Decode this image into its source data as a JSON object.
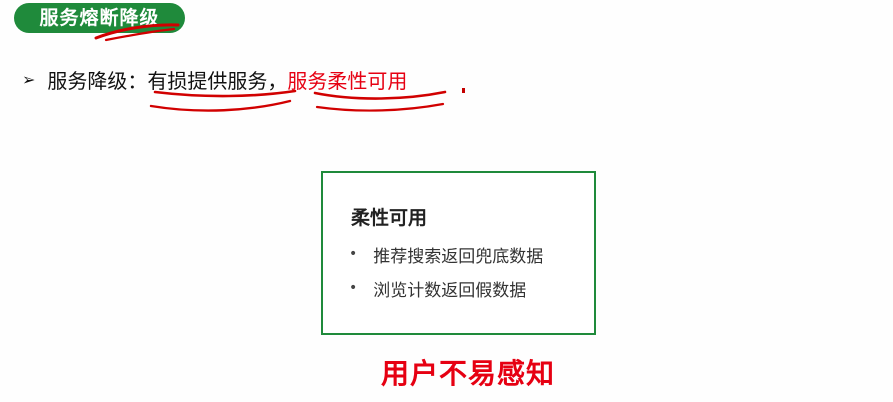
{
  "header": {
    "badge_text": "服务熔断降级"
  },
  "bullet": {
    "lead": "服务降级：",
    "part1": "有损提供服务",
    "sep": "，",
    "part2": "服务柔性可用"
  },
  "card": {
    "title": "柔性可用",
    "items": [
      "推荐搜索返回兜底数据",
      "浏览计数返回假数据"
    ]
  },
  "note": {
    "text": "用户不易感知"
  },
  "colors": {
    "accent_green": "#1f8a3b",
    "highlight_red": "#e60012"
  },
  "icons": {
    "bullet_arrow": "arrow-bullet-icon",
    "list_dot": "bullet-dot-icon"
  }
}
